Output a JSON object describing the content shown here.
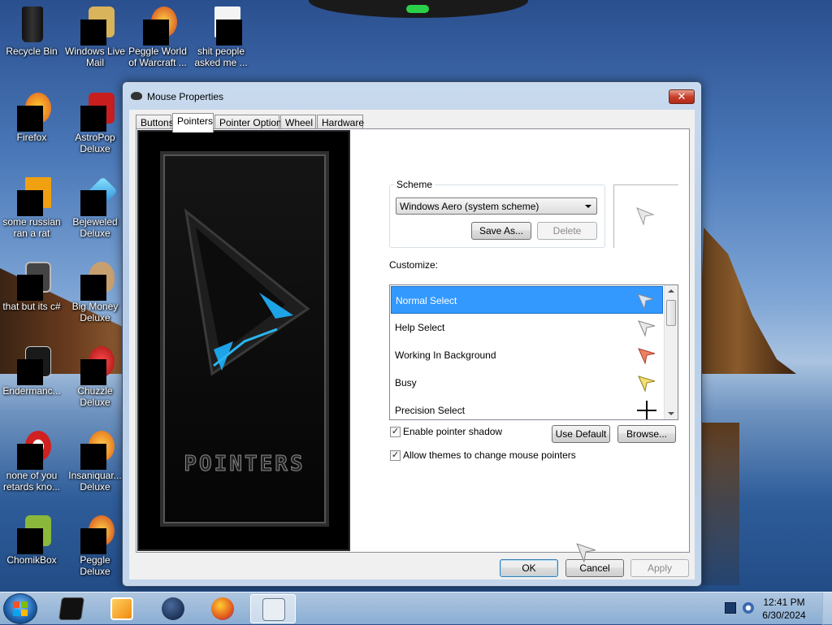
{
  "desktop": {
    "icons": [
      {
        "label": "Recycle Bin",
        "icon": "recycle-bin-icon"
      },
      {
        "label": "Windows Live Mail",
        "icon": "mail-icon"
      },
      {
        "label": "Peggle World of Warcraft ...",
        "icon": "peggle-icon"
      },
      {
        "label": "shit people asked me ...",
        "icon": "text-file-icon"
      },
      {
        "label": "Firefox",
        "icon": "firefox-icon"
      },
      {
        "label": "AstroPop Deluxe",
        "icon": "astropop-icon"
      },
      {
        "label": "some russian ran a rat",
        "icon": "app-icon"
      },
      {
        "label": "Bejeweled Deluxe",
        "icon": "bejeweled-icon"
      },
      {
        "label": "that but its c#",
        "icon": "file-icon"
      },
      {
        "label": "Big Money Deluxe",
        "icon": "money-bag-icon"
      },
      {
        "label": "Endermanc...",
        "icon": "app-icon"
      },
      {
        "label": "Chuzzle Deluxe",
        "icon": "chuzzle-icon"
      },
      {
        "label": "none of you retards kno...",
        "icon": "app-icon"
      },
      {
        "label": "Insaniquar... Deluxe",
        "icon": "insaniquarium-icon"
      },
      {
        "label": "ChomikBox",
        "icon": "chomikbox-icon"
      },
      {
        "label": "Peggle Deluxe",
        "icon": "peggle-icon"
      }
    ]
  },
  "window": {
    "title": "Mouse Properties",
    "close_label": "✕",
    "tabs": [
      {
        "label": "Buttons"
      },
      {
        "label": "Pointers"
      },
      {
        "label": "Pointer Options"
      },
      {
        "label": "Wheel"
      },
      {
        "label": "Hardware"
      }
    ],
    "active_tab": "Pointers",
    "preview_logo": "POINTERS",
    "scheme": {
      "legend": "Scheme",
      "selected": "Windows Aero (system scheme)",
      "save_as": "Save As...",
      "delete": "Delete"
    },
    "customize_label": "Customize:",
    "cursors": [
      {
        "label": "Normal Select",
        "selected": true,
        "icon": "arrow-cursor-icon"
      },
      {
        "label": "Help Select",
        "icon": "help-cursor-icon"
      },
      {
        "label": "Working In Background",
        "icon": "working-cursor-icon"
      },
      {
        "label": "Busy",
        "icon": "busy-cursor-icon"
      },
      {
        "label": "Precision Select",
        "icon": "crosshair-cursor-icon"
      }
    ],
    "enable_shadow": {
      "label": "Enable pointer shadow",
      "checked": true
    },
    "allow_themes": {
      "label": "Allow themes to change mouse pointers",
      "checked": true
    },
    "use_default": "Use Default",
    "browse": "Browse...",
    "ok": "OK",
    "cancel": "Cancel",
    "apply": "Apply"
  },
  "taskbar": {
    "items": [
      {
        "icon": "terminal-icon"
      },
      {
        "icon": "media-player-icon"
      },
      {
        "icon": "globe-icon"
      },
      {
        "icon": "firefox-icon"
      },
      {
        "icon": "control-panel-icon",
        "active": true
      }
    ],
    "clock_time": "12:41 PM",
    "clock_date": "6/30/2024"
  },
  "colors": {
    "selection": "#3399ff",
    "accent": "#3c7fb1"
  }
}
